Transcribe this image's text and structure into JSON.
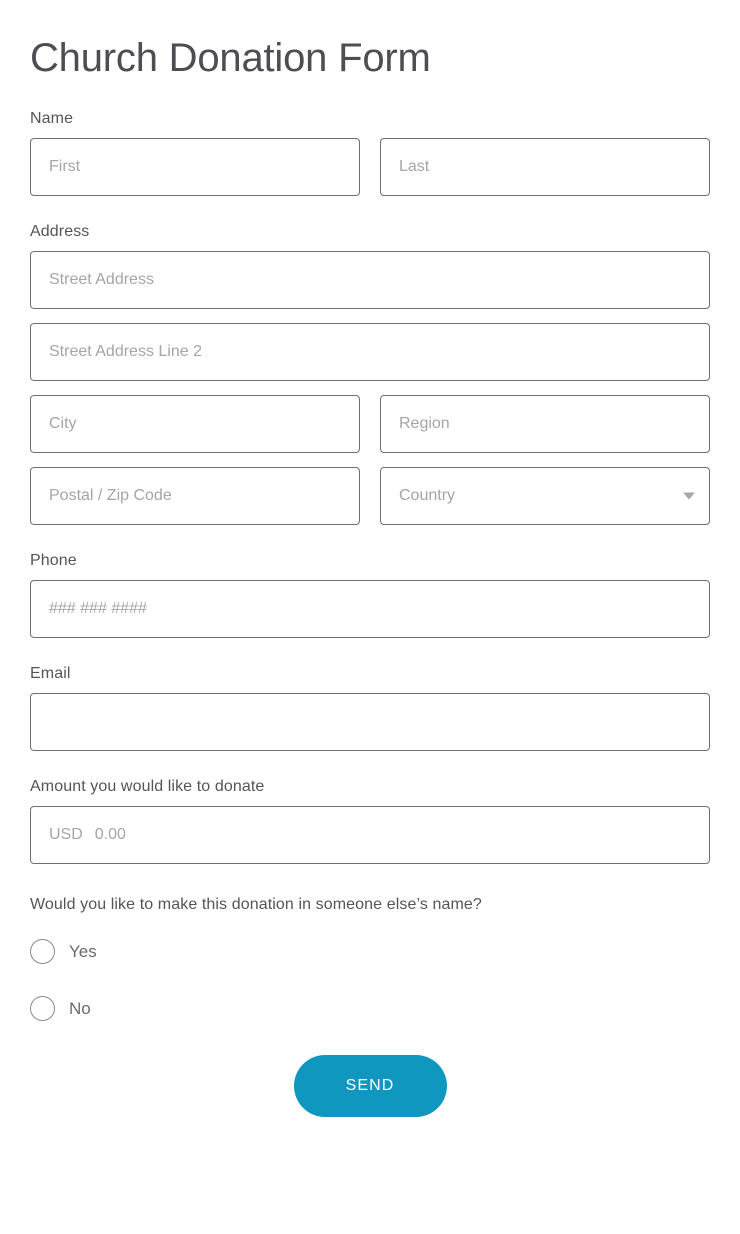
{
  "form": {
    "title": "Church Donation Form",
    "colors": {
      "accent": "#0f97c0",
      "label_text": "#555555",
      "placeholder_text": "#a5a5a5",
      "input_border": "#6f6f6f",
      "title_text": "#4d4e53",
      "background": "#ffffff"
    },
    "fields": {
      "name": {
        "label": "Name",
        "first_placeholder": "First",
        "first_value": "",
        "last_placeholder": "Last",
        "last_value": ""
      },
      "address": {
        "label": "Address",
        "street_placeholder": "Street Address",
        "street_value": "",
        "street2_placeholder": "Street Address Line 2",
        "street2_value": "",
        "city_placeholder": "City",
        "city_value": "",
        "region_placeholder": "Region",
        "region_value": "",
        "postal_placeholder": "Postal / Zip Code",
        "postal_value": "",
        "country_selected": "Country",
        "country_caret_icon": "chevron-down-icon"
      },
      "phone": {
        "label": "Phone",
        "placeholder": "### ### ####",
        "value": ""
      },
      "email": {
        "label": "Email",
        "placeholder": "",
        "value": ""
      },
      "amount": {
        "label": "Amount you would like to donate",
        "currency": "USD",
        "value_placeholder": "0.00"
      },
      "someone_else": {
        "question": "Would you like to make this donation in someone else’s name?",
        "options": [
          {
            "label": "Yes",
            "selected": false
          },
          {
            "label": "No",
            "selected": false
          }
        ]
      }
    },
    "submit": {
      "label": "SEND"
    }
  }
}
